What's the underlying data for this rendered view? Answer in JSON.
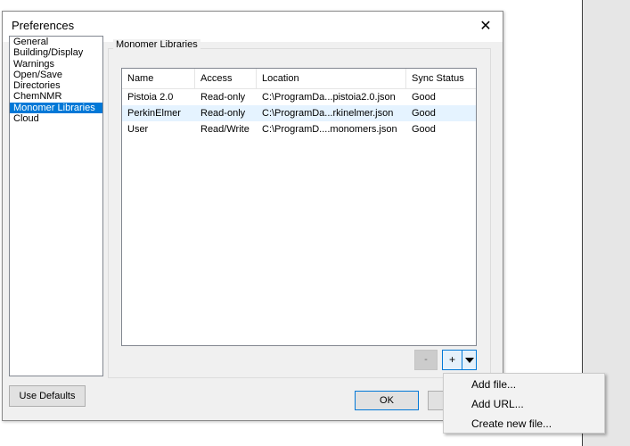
{
  "dialog": {
    "title": "Preferences",
    "close_glyph": "✕"
  },
  "categories": [
    {
      "label": "General",
      "selected": false
    },
    {
      "label": "Building/Display",
      "selected": false
    },
    {
      "label": "Warnings",
      "selected": false
    },
    {
      "label": "Open/Save",
      "selected": false
    },
    {
      "label": "Directories",
      "selected": false
    },
    {
      "label": "ChemNMR",
      "selected": false
    },
    {
      "label": "Monomer Libraries",
      "selected": true
    },
    {
      "label": "Cloud",
      "selected": false
    }
  ],
  "group": {
    "label": "Monomer Libraries"
  },
  "table": {
    "columns": [
      "Name",
      "Access",
      "Location",
      "Sync Status"
    ],
    "rows": [
      {
        "name": "Pistoia 2.0",
        "access": "Read-only",
        "location": "C:\\ProgramDa...pistoia2.0.json",
        "status": "Good"
      },
      {
        "name": "PerkinElmer",
        "access": "Read-only",
        "location": "C:\\ProgramDa...rkinelmer.json",
        "status": "Good"
      },
      {
        "name": "User",
        "access": "Read/Write",
        "location": "C:\\ProgramD....monomers.json",
        "status": "Good"
      }
    ]
  },
  "buttons": {
    "minus": "-",
    "plus": "+",
    "use_defaults": "Use Defaults",
    "ok": "OK"
  },
  "menu": {
    "items": [
      "Add file...",
      "Add URL...",
      "Create new file..."
    ]
  },
  "colors": {
    "selection": "#0078d7",
    "row_hover": "#e5f3ff"
  }
}
